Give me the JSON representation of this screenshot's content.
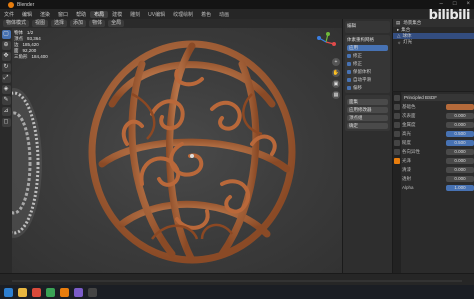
{
  "app": {
    "title": "Blender"
  },
  "menu": {
    "items": [
      "文件",
      "编辑",
      "渲染",
      "窗口",
      "帮助"
    ],
    "workspaces": [
      "布局",
      "建模",
      "雕刻",
      "UV编辑",
      "纹理绘制",
      "着色",
      "动画"
    ]
  },
  "viewport_header": {
    "mode": "物体模式",
    "view": "视图",
    "select": "选择",
    "add": "添加",
    "object": "物体",
    "global": "全局"
  },
  "stats": {
    "rows": [
      [
        "物体",
        "1/2"
      ],
      [
        "顶点",
        "93,364"
      ],
      [
        "边",
        "185,420"
      ],
      [
        "面",
        "92,200"
      ],
      [
        "三角形",
        "184,400"
      ]
    ]
  },
  "npanel": {
    "sections": [
      {
        "title": "编辑",
        "buttons": []
      },
      {
        "title": "体素重构网格",
        "buttons": [
          "应用"
        ]
      }
    ],
    "checks": [
      "修正",
      "修正",
      "保留体积",
      "自动平滑",
      "偏移"
    ],
    "lower_buttons": [
      "面集",
      "应用修改器",
      "顶点组",
      "确定"
    ]
  },
  "outliner": {
    "header": "场景集合",
    "rows": [
      {
        "label": "集合",
        "selected": false
      },
      {
        "label": "球体",
        "selected": true
      },
      {
        "label": "灯光",
        "selected": false
      }
    ]
  },
  "properties": {
    "title": "Principled BSDF",
    "fields": [
      {
        "label": "基础色",
        "value": ""
      },
      {
        "label": "次表面",
        "value": "0.000"
      },
      {
        "label": "金属度",
        "value": "0.000"
      },
      {
        "label": "高光",
        "value": "0.500"
      },
      {
        "label": "糙度",
        "value": "0.500"
      },
      {
        "label": "各向异性",
        "value": "0.000"
      },
      {
        "label": "光泽",
        "value": "0.000"
      },
      {
        "label": "清漆",
        "value": "0.000"
      },
      {
        "label": "透射",
        "value": "0.000"
      },
      {
        "label": "Alpha",
        "value": "1.000"
      }
    ]
  },
  "watermark": "bilibili",
  "colors": {
    "accent": "#e87d0d",
    "select": "#4772b3",
    "object": "#b56a3a"
  }
}
